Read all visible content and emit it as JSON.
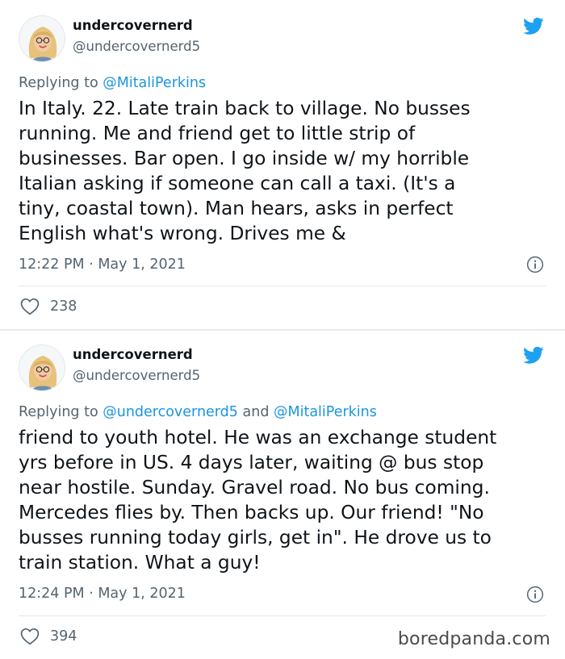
{
  "tweets": [
    {
      "name": "undercovernerd",
      "handle": "@undercovernerd5",
      "reply_prefix": "Replying to ",
      "reply_to": "@MitaliPerkins",
      "reply_joiner": "",
      "reply_to_second": "",
      "lines": [
        "In Italy. 22. Late train back to village. No busses",
        "running. Me and friend get to little strip of",
        "businesses. Bar open. I go inside w/ my horrible",
        "Italian asking if someone can call a taxi. (It's a",
        "tiny, coastal town). Man hears,  asks in perfect",
        "English what's wrong. Drives me &"
      ],
      "timestamp": "12:22 PM · May 1, 2021",
      "likes": "238"
    },
    {
      "name": "undercovernerd",
      "handle": "@undercovernerd5",
      "reply_prefix": "Replying to ",
      "reply_to": "@undercovernerd5",
      "reply_joiner": " and ",
      "reply_to_second": "@MitaliPerkins",
      "lines": [
        "friend to youth hotel. He was an exchange student",
        "yrs before in US. 4 days later, waiting @ bus stop",
        "near hostile. Sunday. Gravel road. No bus coming.",
        "Mercedes flies by. Then backs up. Our friend!  \"No",
        "busses running today girls, get in\". He drove us to",
        "train station. What a guy!"
      ],
      "timestamp": "12:24 PM · May 1, 2021",
      "likes": "394"
    }
  ],
  "icons": {
    "logo": "twitter-bird-icon",
    "info": "info-icon",
    "like": "heart-icon"
  },
  "colors": {
    "twitter_blue": "#1da1f2",
    "mention_blue": "#1b95e0",
    "secondary_text": "#536471",
    "divider": "#e1e8ed"
  },
  "watermark": "boredpanda.com"
}
